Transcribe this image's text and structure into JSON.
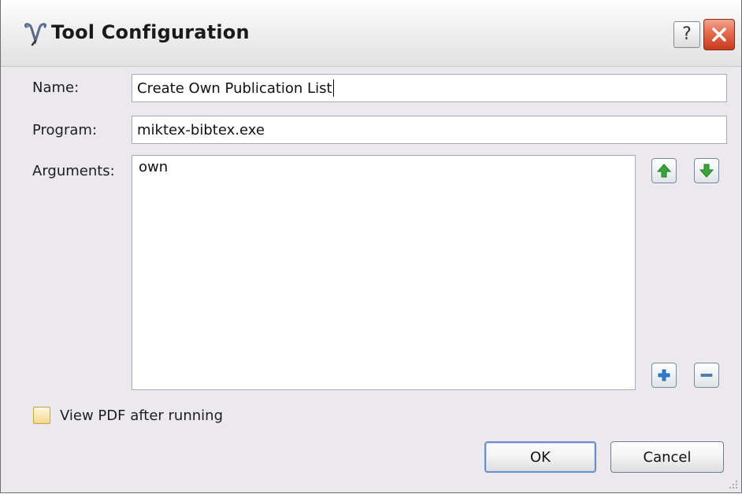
{
  "window": {
    "title": "Tool Configuration",
    "help_glyph": "?",
    "app_icon": "tool-icon",
    "close_icon": "close-icon"
  },
  "form": {
    "name_label": "Name:",
    "name_value": "Create Own Publication List",
    "program_label": "Program:",
    "program_value": "miktex-bibtex.exe",
    "arguments_label": "Arguments:",
    "arguments": [
      "own"
    ]
  },
  "argument_controls": {
    "move_up_icon": "arrow-up-icon",
    "move_down_icon": "arrow-down-icon",
    "add_icon": "plus-icon",
    "remove_icon": "minus-icon"
  },
  "options": {
    "view_pdf_label": "View PDF after running",
    "view_pdf_checked": false
  },
  "buttons": {
    "ok_label": "OK",
    "cancel_label": "Cancel"
  },
  "colors": {
    "dialog_background": "#ebe9ed",
    "close_button": "#d9502f",
    "arrow_green": "#3aa53a",
    "plus_blue": "#2f7fd0",
    "checkbox_border": "#caa24a"
  }
}
